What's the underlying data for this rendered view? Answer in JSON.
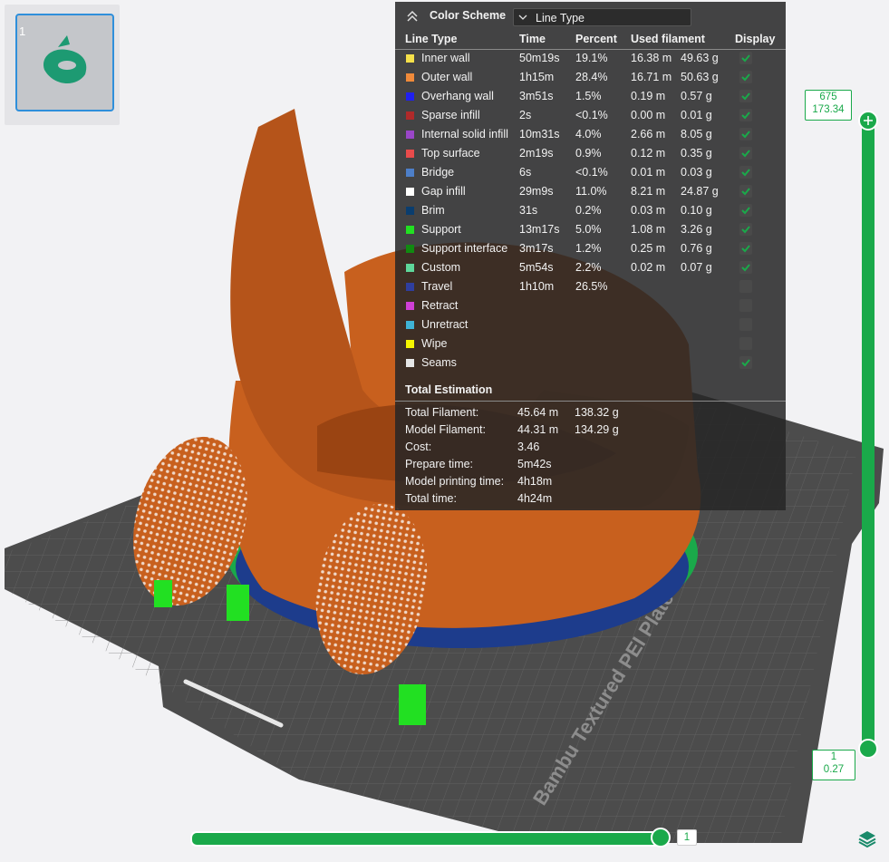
{
  "thumbnail": {
    "plate_number": "1"
  },
  "legend": {
    "color_scheme_label": "Color Scheme",
    "color_scheme_value": "Line Type",
    "columns": [
      "Line Type",
      "Time",
      "Percent",
      "Used filament",
      "Display"
    ],
    "rows": [
      {
        "name": "Inner wall",
        "color": "#f5e04a",
        "time": "50m19s",
        "percent": "19.1%",
        "length": "16.38 m",
        "weight": "49.63 g",
        "display": true
      },
      {
        "name": "Outer wall",
        "color": "#f08a3a",
        "time": "1h15m",
        "percent": "28.4%",
        "length": "16.71 m",
        "weight": "50.63 g",
        "display": true
      },
      {
        "name": "Overhang wall",
        "color": "#2020f0",
        "time": "3m51s",
        "percent": "1.5%",
        "length": "0.19 m",
        "weight": "0.57 g",
        "display": true
      },
      {
        "name": "Sparse infill",
        "color": "#b02a2a",
        "time": "2s",
        "percent": "<0.1%",
        "length": "0.00 m",
        "weight": "0.01 g",
        "display": true
      },
      {
        "name": "Internal solid infill",
        "color": "#9a46c8",
        "time": "10m31s",
        "percent": "4.0%",
        "length": "2.66 m",
        "weight": "8.05 g",
        "display": true
      },
      {
        "name": "Top surface",
        "color": "#e84b4b",
        "time": "2m19s",
        "percent": "0.9%",
        "length": "0.12 m",
        "weight": "0.35 g",
        "display": true
      },
      {
        "name": "Bridge",
        "color": "#4d7fc9",
        "time": "6s",
        "percent": "<0.1%",
        "length": "0.01 m",
        "weight": "0.03 g",
        "display": true
      },
      {
        "name": "Gap infill",
        "color": "#ffffff",
        "time": "29m9s",
        "percent": "11.0%",
        "length": "8.21 m",
        "weight": "24.87 g",
        "display": true
      },
      {
        "name": "Brim",
        "color": "#0a3d6e",
        "time": "31s",
        "percent": "0.2%",
        "length": "0.03 m",
        "weight": "0.10 g",
        "display": true
      },
      {
        "name": "Support",
        "color": "#22e022",
        "time": "13m17s",
        "percent": "5.0%",
        "length": "1.08 m",
        "weight": "3.26 g",
        "display": true
      },
      {
        "name": "Support interface",
        "color": "#118a11",
        "time": "3m17s",
        "percent": "1.2%",
        "length": "0.25 m",
        "weight": "0.76 g",
        "display": true
      },
      {
        "name": "Custom",
        "color": "#5ed79a",
        "time": "5m54s",
        "percent": "2.2%",
        "length": "0.02 m",
        "weight": "0.07 g",
        "display": true
      },
      {
        "name": "Travel",
        "color": "#2f3e9e",
        "time": "1h10m",
        "percent": "26.5%",
        "length": "",
        "weight": "",
        "display": false
      },
      {
        "name": "Retract",
        "color": "#cf3fd6",
        "time": "",
        "percent": "",
        "length": "",
        "weight": "",
        "display": false
      },
      {
        "name": "Unretract",
        "color": "#3fb3d6",
        "time": "",
        "percent": "",
        "length": "",
        "weight": "",
        "display": false
      },
      {
        "name": "Wipe",
        "color": "#f5f500",
        "time": "",
        "percent": "",
        "length": "",
        "weight": "",
        "display": false
      },
      {
        "name": "Seams",
        "color": "#e6e6e6",
        "time": "",
        "percent": "",
        "length": "",
        "weight": "",
        "display": true
      }
    ],
    "total_title": "Total Estimation",
    "totals": [
      {
        "label": "Total Filament:",
        "v1": "45.64 m",
        "v2": "138.32 g"
      },
      {
        "label": "Model Filament:",
        "v1": "44.31 m",
        "v2": "134.29 g"
      },
      {
        "label": "Cost:",
        "v1": "3.46",
        "v2": ""
      },
      {
        "label": "Prepare time:",
        "v1": "5m42s",
        "v2": ""
      },
      {
        "label": "Model printing time:",
        "v1": "4h18m",
        "v2": ""
      },
      {
        "label": "Total time:",
        "v1": "4h24m",
        "v2": ""
      }
    ]
  },
  "vertical_slider": {
    "top_layer": "675",
    "top_height": "173.34",
    "bottom_layer": "1",
    "bottom_height": "0.27"
  },
  "horizontal_slider": {
    "value": "1"
  },
  "plate_label": "Bambu Textured PEI Plate",
  "colors": {
    "accent": "#1aa94a",
    "model": "#c8601e"
  }
}
